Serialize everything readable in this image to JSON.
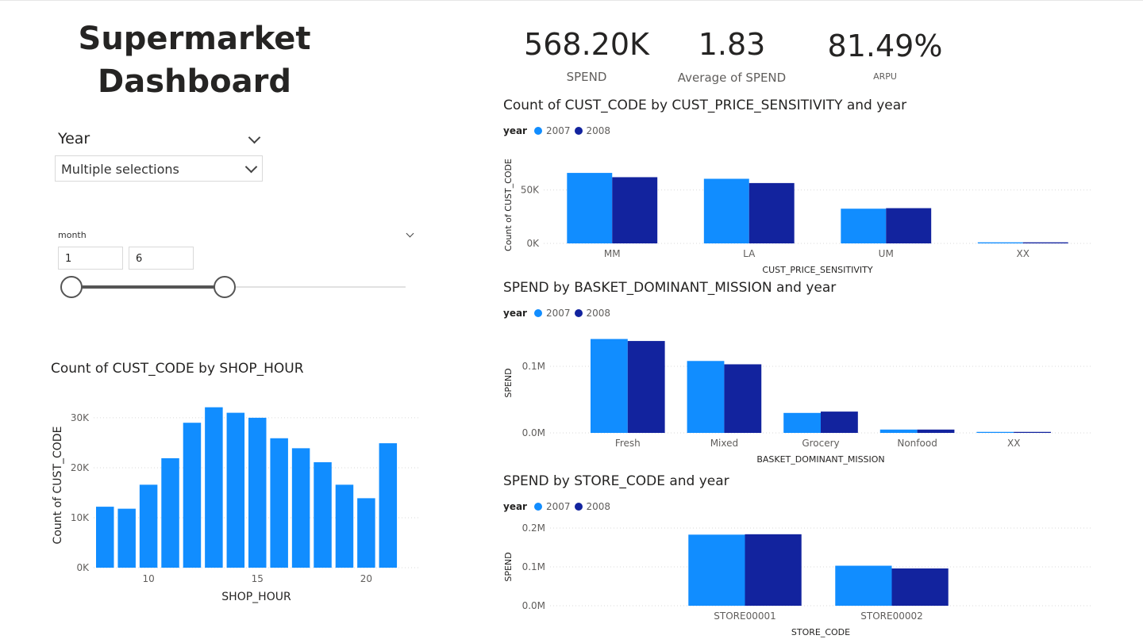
{
  "page": {
    "title_line1": "Supermarket",
    "title_line2": "Dashboard"
  },
  "slicers": {
    "year_label": "Year",
    "year_value": "Multiple selections",
    "month_label": "month",
    "month_from": "1",
    "month_to": "6",
    "month_from_fraction": 0.0,
    "month_to_fraction": 0.458
  },
  "kpis": [
    {
      "value": "568.20K",
      "label": "SPEND"
    },
    {
      "value": "1.83",
      "label": "Average of SPEND"
    },
    {
      "value": "81.49%",
      "label": "ARPU"
    }
  ],
  "colors": {
    "series_2007": "#118dff",
    "series_2008": "#12239e",
    "grid": "#d9d9d9"
  },
  "legend": {
    "title": "year",
    "items": [
      "2007",
      "2008"
    ]
  },
  "chart_data": [
    {
      "id": "hour",
      "type": "bar",
      "title": "Count of CUST_CODE by SHOP_HOUR",
      "xlabel": "SHOP_HOUR",
      "ylabel": "Count of CUST_CODE",
      "x": [
        8,
        9,
        10,
        11,
        12,
        13,
        14,
        15,
        16,
        17,
        18,
        19,
        20,
        21
      ],
      "values": [
        12200,
        11800,
        16600,
        21900,
        29000,
        32100,
        31000,
        30000,
        25900,
        23900,
        21100,
        16600,
        13900,
        24900
      ],
      "xticks": [
        10,
        15,
        20
      ],
      "yticks": [
        0,
        10000,
        20000,
        30000
      ],
      "yticklabels": [
        "0K",
        "10K",
        "20K",
        "30K"
      ],
      "ylim": [
        0,
        33000
      ],
      "grid": true
    },
    {
      "id": "sens",
      "type": "bar",
      "title": "Count of CUST_CODE by CUST_PRICE_SENSITIVITY and year",
      "xlabel": "CUST_PRICE_SENSITIVITY",
      "ylabel": "Count of CUST_CODE",
      "categories": [
        "MM",
        "LA",
        "UM",
        "XX"
      ],
      "series": [
        {
          "name": "2007",
          "values": [
            66000,
            60500,
            32500,
            1000
          ]
        },
        {
          "name": "2008",
          "values": [
            62000,
            56500,
            33000,
            1000
          ]
        }
      ],
      "yticks": [
        0,
        50000
      ],
      "yticklabels": [
        "0K",
        "50K"
      ],
      "ylim": [
        0,
        72000
      ],
      "grid": true
    },
    {
      "id": "mission",
      "type": "bar",
      "title": "SPEND by BASKET_DOMINANT_MISSION and year",
      "xlabel": "BASKET_DOMINANT_MISSION",
      "ylabel": "SPEND",
      "categories": [
        "Fresh",
        "Mixed",
        "Grocery",
        "Nonfood",
        "XX"
      ],
      "series": [
        {
          "name": "2007",
          "values": [
            141000,
            108000,
            30000,
            5000,
            1500
          ]
        },
        {
          "name": "2008",
          "values": [
            138000,
            103000,
            32000,
            5000,
            1500
          ]
        }
      ],
      "yticks": [
        0,
        100000
      ],
      "yticklabels": [
        "0.0M",
        "0.1M"
      ],
      "ylim": [
        0,
        150000
      ],
      "grid": true
    },
    {
      "id": "store",
      "type": "bar",
      "title": "SPEND by STORE_CODE and year",
      "xlabel": "STORE_CODE",
      "ylabel": "SPEND",
      "categories": [
        "STORE00001",
        "STORE00002"
      ],
      "series": [
        {
          "name": "2007",
          "values": [
            183000,
            103000
          ]
        },
        {
          "name": "2008",
          "values": [
            184000,
            96000
          ]
        }
      ],
      "yticks": [
        0,
        100000,
        200000
      ],
      "yticklabels": [
        "0.0M",
        "0.1M",
        "0.2M"
      ],
      "ylim": [
        0,
        200000
      ],
      "grid": true
    }
  ]
}
